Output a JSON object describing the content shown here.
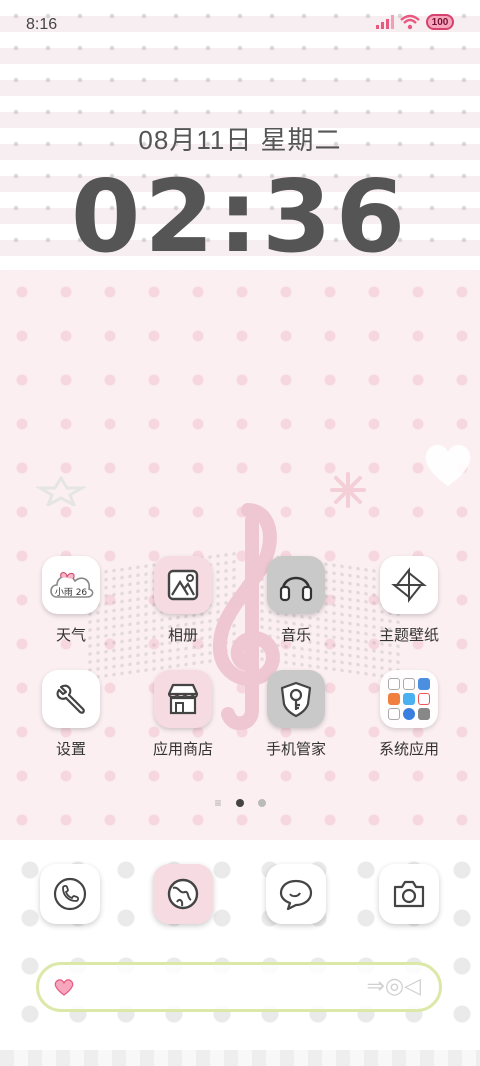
{
  "status_bar": {
    "time": "8:16",
    "battery": "100",
    "accent_color": "#e8587f"
  },
  "lockscreen": {
    "date": "08月11日 星期二",
    "time": "02:36"
  },
  "apps": [
    {
      "label": "天气",
      "icon": "weather-icon",
      "weather_text": "小雨 26"
    },
    {
      "label": "相册",
      "icon": "gallery-icon"
    },
    {
      "label": "音乐",
      "icon": "headphones-icon"
    },
    {
      "label": "主题壁纸",
      "icon": "theme-icon"
    },
    {
      "label": "设置",
      "icon": "wrench-icon"
    },
    {
      "label": "应用商店",
      "icon": "store-icon"
    },
    {
      "label": "手机管家",
      "icon": "key-shield-icon"
    },
    {
      "label": "系统应用",
      "icon": "folder-icon"
    }
  ],
  "page_indicator": {
    "pages": 2,
    "current": 1
  },
  "dock": [
    {
      "icon": "phone-icon"
    },
    {
      "icon": "browser-globe-icon"
    },
    {
      "icon": "message-bubble-icon"
    },
    {
      "icon": "camera-icon"
    }
  ],
  "search_bar": {
    "icon": "heart-icon"
  }
}
